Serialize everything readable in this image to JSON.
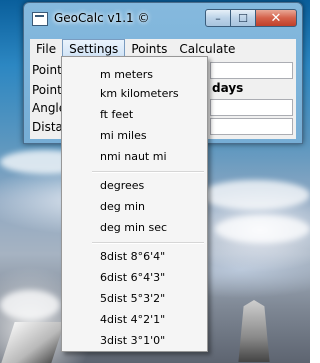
{
  "window": {
    "title": "GeoCalc v1.1 ©",
    "buttons": {
      "minimize": "–",
      "maximize": "☐",
      "close": "✕"
    }
  },
  "menubar": [
    "File",
    "Settings",
    "Points",
    "Calculate"
  ],
  "rows": [
    {
      "label": "Point",
      "value": ""
    },
    {
      "label": "Point",
      "value": "days"
    },
    {
      "label": "Angle",
      "value": ""
    },
    {
      "label": "Distar",
      "value": ""
    }
  ],
  "settings_menu": {
    "units": [
      "m meters",
      "km kilometers",
      "ft feet",
      "mi miles",
      "nmi naut mi"
    ],
    "angle_formats": [
      "degrees",
      "deg min",
      "deg min sec"
    ],
    "precision": [
      "8dist 8°6'4\"",
      "6dist 6°4'3\"",
      "5dist 5°3'2\"",
      "4dist 4°2'1\"",
      "3dist 3°1'0\""
    ]
  }
}
